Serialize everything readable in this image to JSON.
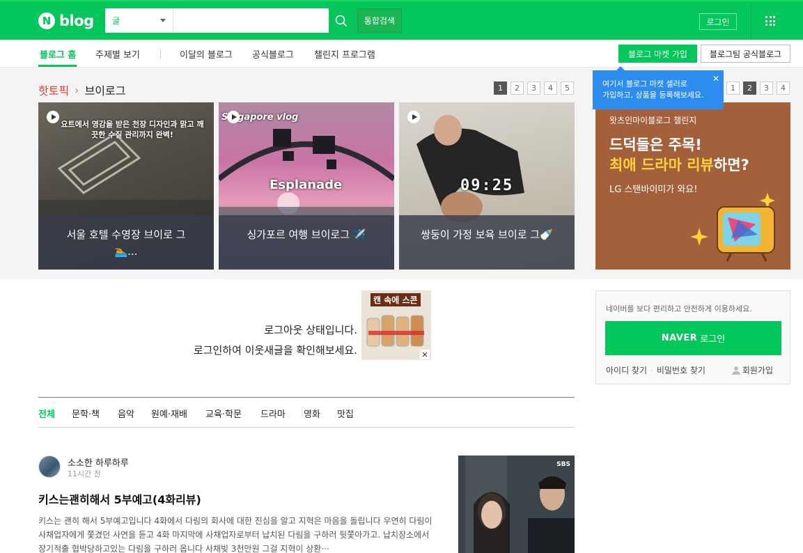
{
  "header": {
    "logo_mark": "N",
    "logo_text": "blog",
    "search_select": "글",
    "search_placeholder": "",
    "total_search": "통합검색",
    "login": "로그인"
  },
  "nav": {
    "items": [
      "블로그 홈",
      "주제별 보기",
      "이달의 블로그",
      "공식블로그",
      "챌린지 프로그램"
    ],
    "market_join": "블로그 마켓 가입",
    "team_blog": "블로그팀 공식블로그"
  },
  "tooltip": {
    "line1": "여기서 블로그 마켓 셀러로",
    "line2": "가입하고, 상품을 등록해보세요.",
    "close": "✕"
  },
  "hot": {
    "label_red": "핫토픽",
    "label_topic": "브이로그",
    "pages_left": [
      "1",
      "2",
      "3",
      "4",
      "5"
    ],
    "pages_right": [
      "1",
      "2",
      "3",
      "4"
    ],
    "cards": [
      {
        "caption": "서울 호텔 수영장 브이로 그🏊...",
        "overlay": "요트에서 영감을 받은 천장 디자인과 맑고 깨끗한 수질 관리까지 완벽!"
      },
      {
        "caption": "싱가포르 여행 브이로그 ✈️",
        "overlay": "Esplanade",
        "overlay2": "Singapore vlog"
      },
      {
        "caption": "쌍둥이 가정 보육 브이로 그🍼",
        "overlay": "09:25"
      }
    ]
  },
  "ad": {
    "small": "왓츠인마이블로그 챌린지",
    "big1": "드덕들은 주목!",
    "big2_yellow": "최애 드라마 리뷰",
    "big2_rest": "하면?",
    "sub": "LG 스탠바이미가 와요!"
  },
  "logged_out": {
    "line1": "로그아웃 상태입니다.",
    "line2": "로그인하여 이웃새글을 확인해보세요.",
    "can_ad_title": "캔 속에 스콘",
    "can_ad_close": "✕"
  },
  "login_box": {
    "desc": "네이버를 보다 편리하고 안전하게 이용하세요.",
    "button_brand": "NAVER",
    "button_text": "로그인",
    "find_id": "아이디 찾기",
    "find_pw": "비밀번호 찾기",
    "signup": "회원가입"
  },
  "categories": [
    "전체",
    "문학·책",
    "음악",
    "원예·재배",
    "교육·학문",
    "드라마",
    "영화",
    "맛집"
  ],
  "post": {
    "author": "소소한 하루하루",
    "time": "11시간 전",
    "title": "키스는괜히해서 5부예고(4화리뷰)",
    "body": "키스는 괜히 해서 5부예고입니다 4화에서 다림의 회사에 대한 진심을 알고 지혁은 마음을 돌립니다 우연히 다림이 사채업자에게 쫓겼던 사연을 듣고 4화 마지막에 사채업자로부터 납치된 다림을 구하러 뒷쫓아가고. 납치장소에서 장기적출 협박당하고있는 다림을 구하러 옵니다 사채빚 3천만원 그걸 지혁이 상환···",
    "thumb_badge": "SBS"
  },
  "colors": {
    "brand": "#03c75a",
    "hot_red": "#e53935",
    "tooltip_blue": "#2d8cf0",
    "ad_bg": "#a4603b"
  }
}
